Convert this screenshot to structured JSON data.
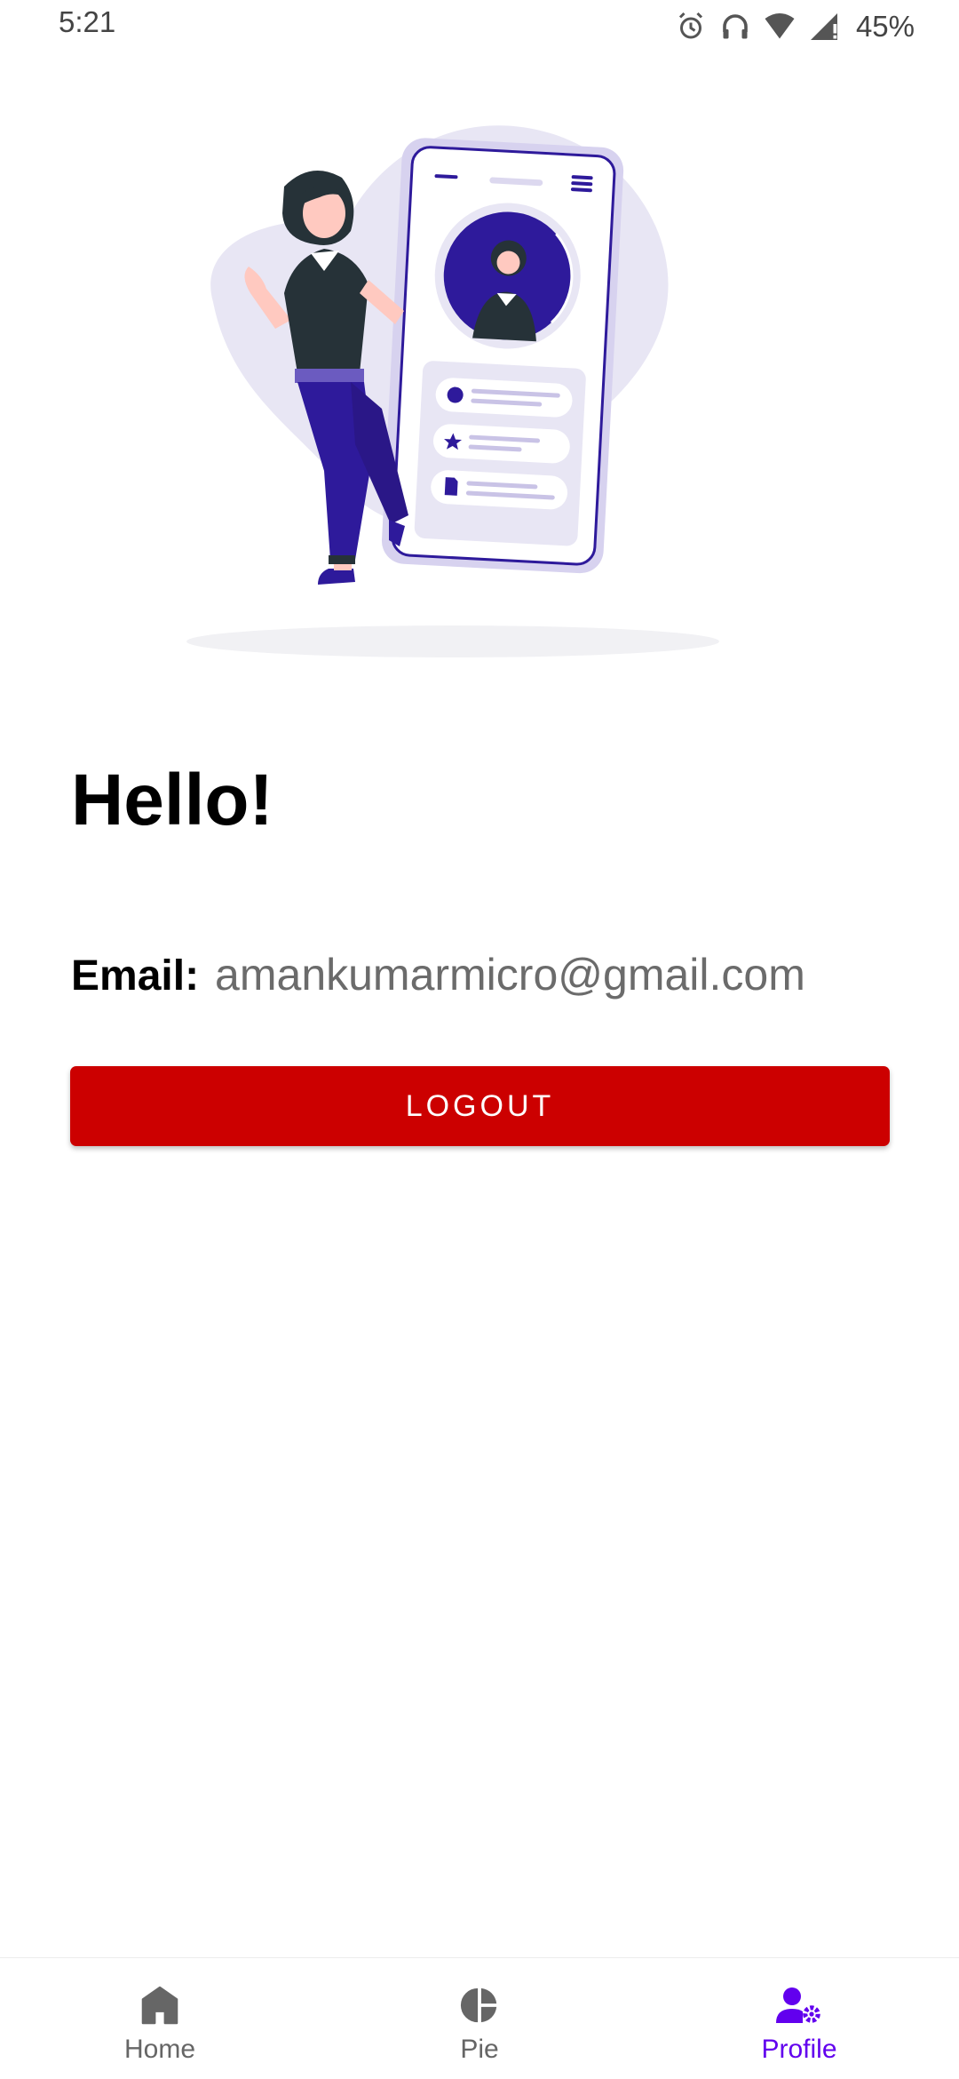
{
  "status_bar": {
    "time": "5:21",
    "battery": "45%",
    "icons": [
      "alarm-icon",
      "headphones-icon",
      "wifi-icon",
      "signal-icon",
      "battery-icon"
    ]
  },
  "profile": {
    "greeting": "Hello!",
    "email_label": "Email:",
    "email_value": "amankumarmicro@gmail.com",
    "logout_label": "LOGOUT"
  },
  "bottom_nav": {
    "items": [
      {
        "label": "Home",
        "icon": "home-icon",
        "active": false
      },
      {
        "label": "Pie",
        "icon": "pie-chart-icon",
        "active": false
      },
      {
        "label": "Profile",
        "icon": "profile-settings-icon",
        "active": true
      }
    ]
  },
  "colors": {
    "logout_button": "#cc0000",
    "active_nav": "#6200ee",
    "inactive_nav": "#666666",
    "illustration_accent": "#2e1a9b",
    "illustration_light": "#e8e6f4"
  }
}
